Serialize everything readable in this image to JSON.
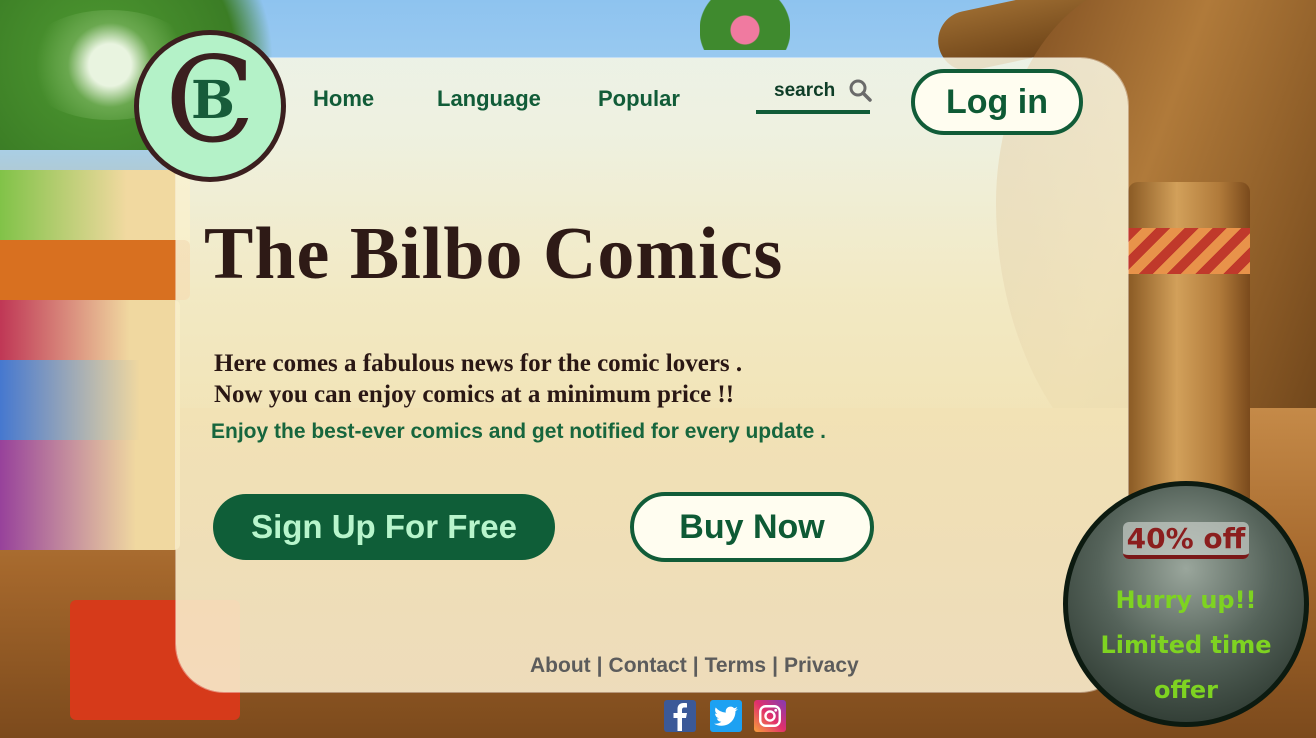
{
  "logo": {
    "letter_outer": "C",
    "letter_inner": "B"
  },
  "nav": {
    "home": "Home",
    "language": "Language",
    "popular": "Popular"
  },
  "search": {
    "placeholder": "search"
  },
  "login": {
    "label": "Log in"
  },
  "hero": {
    "title": "The Bilbo Comics",
    "line1": "Here comes a fabulous news for the comic lovers .",
    "line2": "Now you can enjoy comics at a minimum price !!",
    "line3": "Enjoy the best-ever comics and get notified for every update ."
  },
  "buttons": {
    "signup": "Sign Up For Free",
    "buy": "Buy Now"
  },
  "footer": {
    "links": [
      "About",
      "Contact",
      "Terms",
      "Privacy"
    ],
    "separator": "|"
  },
  "social": {
    "icons": [
      "facebook-icon",
      "twitter-icon",
      "instagram-icon"
    ]
  },
  "offer": {
    "title": "40% off",
    "line1": "Hurry up!!",
    "line2": "Limited time",
    "line3": "offer"
  },
  "colors": {
    "brand_green": "#115c38",
    "signup_text": "#b8f5cc",
    "title": "#2e1a16",
    "offer_red": "#8b1e1e",
    "offer_green": "#7ed321"
  }
}
